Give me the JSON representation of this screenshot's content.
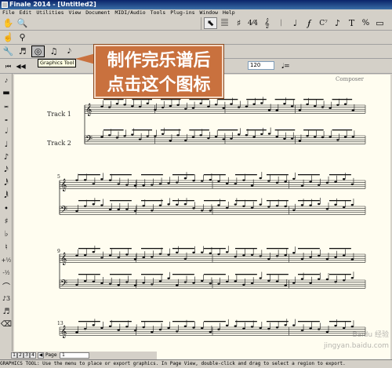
{
  "window": {
    "title": "Finale 2014 - [Untitled2]"
  },
  "menubar": {
    "items": [
      "File",
      "Edit",
      "Utilities",
      "View",
      "Document",
      "MIDI/Audio",
      "Tools",
      "Plug-ins",
      "Window",
      "Help"
    ]
  },
  "toolbar": {
    "tempo_value": "120",
    "tooltip": "Graphics Tool"
  },
  "callout": {
    "line1": "制作完乐谱后",
    "line2": "点击这个图标"
  },
  "score": {
    "composer": "Composer",
    "track1": "Track 1",
    "track2": "Track 2",
    "measure_numbers": [
      "5",
      "9",
      "13"
    ]
  },
  "navbar": {
    "page_label": "Page",
    "page_value": "1",
    "tabs": [
      "1",
      "2",
      "3",
      "4"
    ]
  },
  "status": {
    "text": "GRAPHICS TOOL: Use the menu to place or export graphics. In Page View, double-click and drag to select a region to export."
  },
  "icons": {
    "sidebar": [
      "grace-note-icon",
      "whole-rest-icon",
      "breve-icon",
      "whole-note-icon",
      "half-note-icon",
      "quarter-note-icon",
      "eighth-note-icon",
      "sixteenth-note-icon",
      "thirty-second-note-icon",
      "sixty-fourth-note-icon",
      "dot-icon",
      "sharp-icon",
      "flat-icon",
      "natural-icon",
      "half-step-up-icon",
      "half-step-down-icon",
      "tie-icon",
      "tuplet-icon",
      "slur-icon",
      "eraser-icon"
    ]
  },
  "colors": {
    "callout": "#c9713e",
    "titlebar": "#0a246a",
    "page": "#fffdf0"
  }
}
